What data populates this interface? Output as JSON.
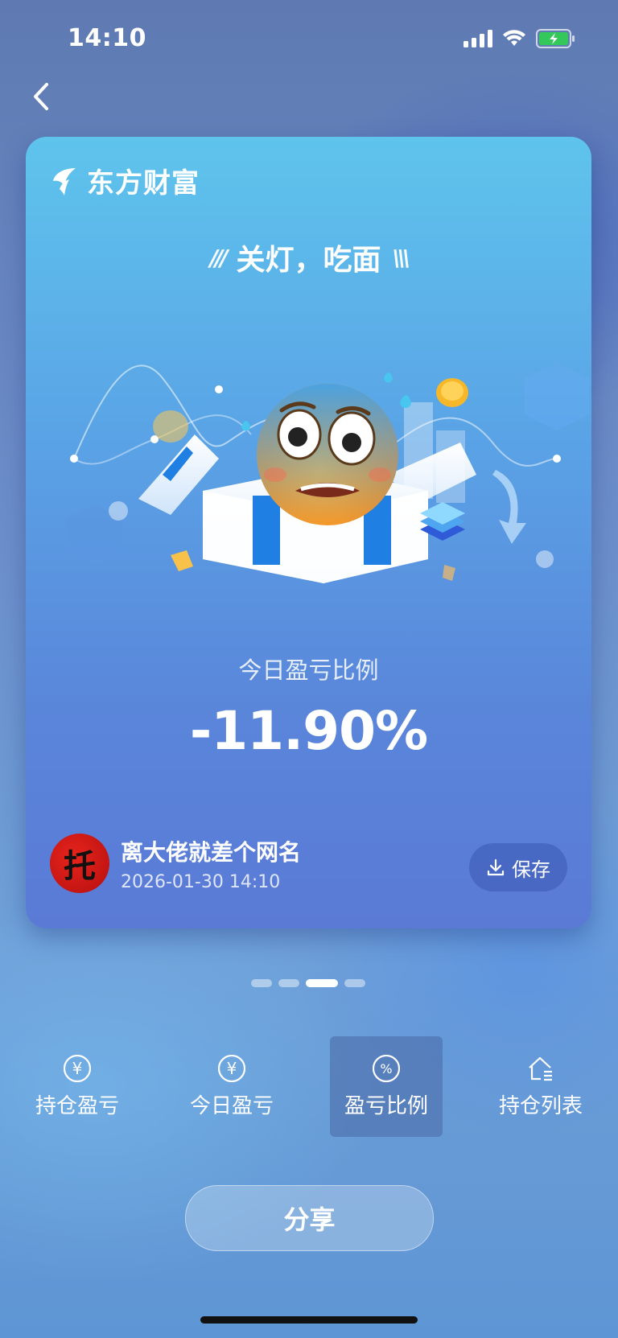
{
  "status_bar": {
    "time": "14:10",
    "battery_color": "#34c759"
  },
  "card": {
    "brand_name": "东方财富",
    "slogan": "关灯，吃面",
    "slogan_left_marks": "///",
    "slogan_right_marks": "\\\\\\",
    "ratio_label": "今日盈亏比例",
    "ratio_value": "-11.90%",
    "user_name": "离大佬就差个网名",
    "user_time": "2026-01-30 14:10",
    "avatar_char": "托",
    "save_label": "保存"
  },
  "pager": {
    "count": 4,
    "active_index": 2
  },
  "tabs": [
    {
      "label": "持仓盈亏",
      "icon": "yen-circle-icon",
      "glyph": "¥"
    },
    {
      "label": "今日盈亏",
      "icon": "yen-circle-icon",
      "glyph": "¥"
    },
    {
      "label": "盈亏比例",
      "icon": "percent-circle-icon",
      "glyph": "%",
      "active": true
    },
    {
      "label": "持仓列表",
      "icon": "house-list-icon"
    }
  ],
  "share_label": "分享"
}
